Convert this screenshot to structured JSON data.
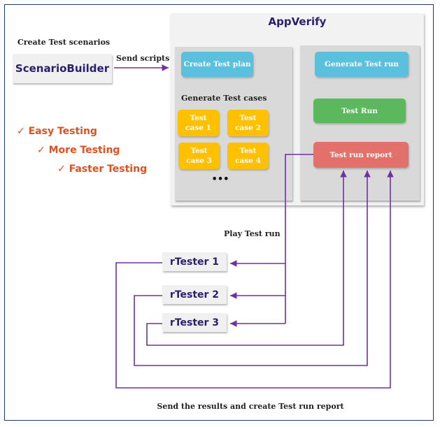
{
  "left": {
    "heading": "Create Test scenarios",
    "scenario_builder": "ScenarioBuilder",
    "send_scripts": "Send scripts",
    "benefits": [
      "Easy Testing",
      "More Testing",
      "Faster Testing"
    ]
  },
  "app": {
    "title": "AppVerify",
    "create_plan": "Create Test plan",
    "generate_cases": "Generate Test cases",
    "cases": [
      [
        "Test",
        "case 1"
      ],
      [
        "Test",
        "case 2"
      ],
      [
        "Test",
        "case 3"
      ],
      [
        "Test",
        "case 4"
      ]
    ],
    "more": "•••",
    "generate_run": "Generate Test run",
    "test_run": "Test Run",
    "report": "Test run report"
  },
  "play_label": "Play Test run",
  "testers": [
    "rTester 1",
    "rTester 2",
    "rTester 3"
  ],
  "bottom_label": "Send the results and create Test run report",
  "colors": {
    "arrow": "#7030a0",
    "blue": "#5bc0de",
    "green": "#5cb85c",
    "red": "#e3716b",
    "yellow": "#ffc000",
    "check": "#e05020"
  }
}
